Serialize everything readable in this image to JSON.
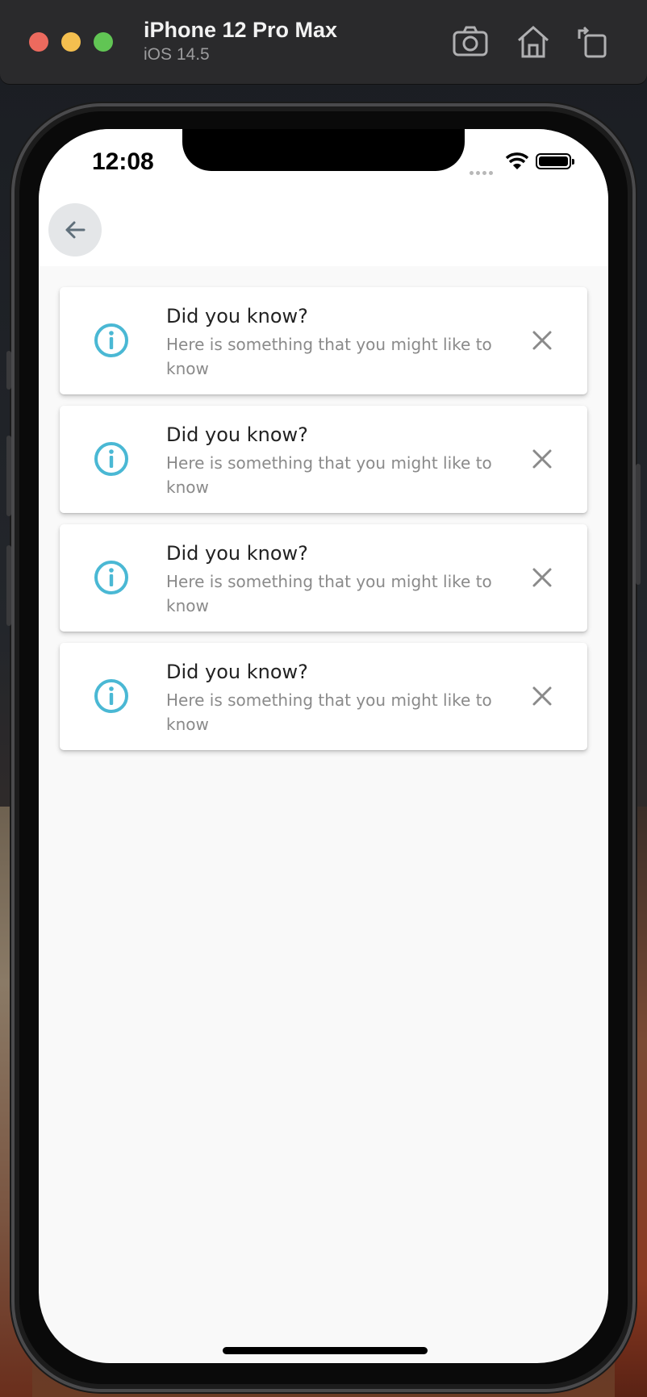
{
  "simulator": {
    "device_name": "iPhone 12 Pro Max",
    "os_version": "iOS 14.5",
    "icons": [
      "screenshot-icon",
      "home-icon",
      "rotate-icon"
    ]
  },
  "statusbar": {
    "time": "12:08"
  },
  "nav": {
    "back_icon": "arrow-left-icon"
  },
  "cards": [
    {
      "title": "Did you know?",
      "body": "Here is something that you might like to know"
    },
    {
      "title": "Did you know?",
      "body": "Here is something that you might like to know"
    },
    {
      "title": "Did you know?",
      "body": "Here is something that you might like to know"
    },
    {
      "title": "Did you know?",
      "body": "Here is something that you might like to know"
    }
  ],
  "colors": {
    "info_accent": "#4ab8d4",
    "close_gray": "#8a8a8a"
  }
}
